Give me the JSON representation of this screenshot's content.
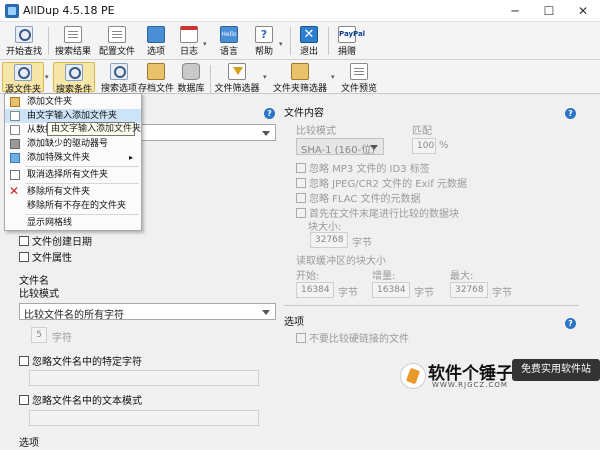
{
  "window": {
    "title": "AllDup 4.5.18 PE",
    "minimize": "─",
    "maximize": "☐",
    "close": "✕"
  },
  "ribbon": {
    "row1": [
      "开始查找",
      "搜索结果",
      "配置文件",
      "选项",
      "日志",
      "语言",
      "帮助",
      "退出",
      "捐赠"
    ],
    "row2": [
      "源文件夹",
      "搜索条件",
      "搜索选项",
      "存档文件",
      "数据库",
      "文件筛选器",
      "文件夹筛选器",
      "文件预览"
    ],
    "help_glyph": "?",
    "hello_glyph": "Hello",
    "paypal_glyph": "PayPal",
    "exit_glyph": "✕",
    "dropdown_glyph": "▾"
  },
  "menu": {
    "items": [
      "添加文件夹",
      "由文字输入添加文件夹",
      "从数据库",
      "添加缺少的驱动器号",
      "添加特殊文件夹",
      "取消选择所有文件夹",
      "移除所有文件夹",
      "移除所有不存在的文件夹",
      "显示网格线"
    ],
    "submenu_arrow": "▸",
    "tooltip": "由文字输入添加文件夹"
  },
  "left": {
    "select_top_value": "",
    "chk_created": "文件创建日期",
    "chk_attr": "文件属性",
    "filename_heading": "文件名",
    "compare_mode_label": "比较模式",
    "compare_select": "比较文件名的所有字符",
    "char_count": "5",
    "char_unit": "字符",
    "ignore_specific": "忽略文件名中的特定字符",
    "ignore_pattern": "忽略文件名中的文本模式",
    "options_heading": "选项"
  },
  "right": {
    "content_heading": "文件内容",
    "compare_mode_label": "比较模式",
    "match_label": "匹配",
    "hash_select": "SHA-1 (160-位)",
    "match_value": "100",
    "percent": "%",
    "ignore_mp3": "忽略 MP3 文件的 ID3 标签",
    "ignore_jpeg": "忽略 JPEG/CR2 文件的 Exif 元数据",
    "ignore_flac": "忽略 FLAC 文件的元数据",
    "compare_tail": "首先在文件末尾进行比较的数据块",
    "block_size_label": "块大小:",
    "block_size_value": "32768",
    "byte": "字节",
    "buffer_label": "读取缓冲区的块大小",
    "start_label": "开始:",
    "start_value": "16384",
    "inc_label": "增量:",
    "inc_value": "16384",
    "max_label": "最大:",
    "max_value": "32768",
    "options_heading": "选项",
    "no_hardlink": "不要比较硬链接的文件"
  },
  "watermark": {
    "title": "软件个锤子",
    "sub": "WWW.RJGCZ.COM",
    "slogan": "免费实用软件站"
  }
}
